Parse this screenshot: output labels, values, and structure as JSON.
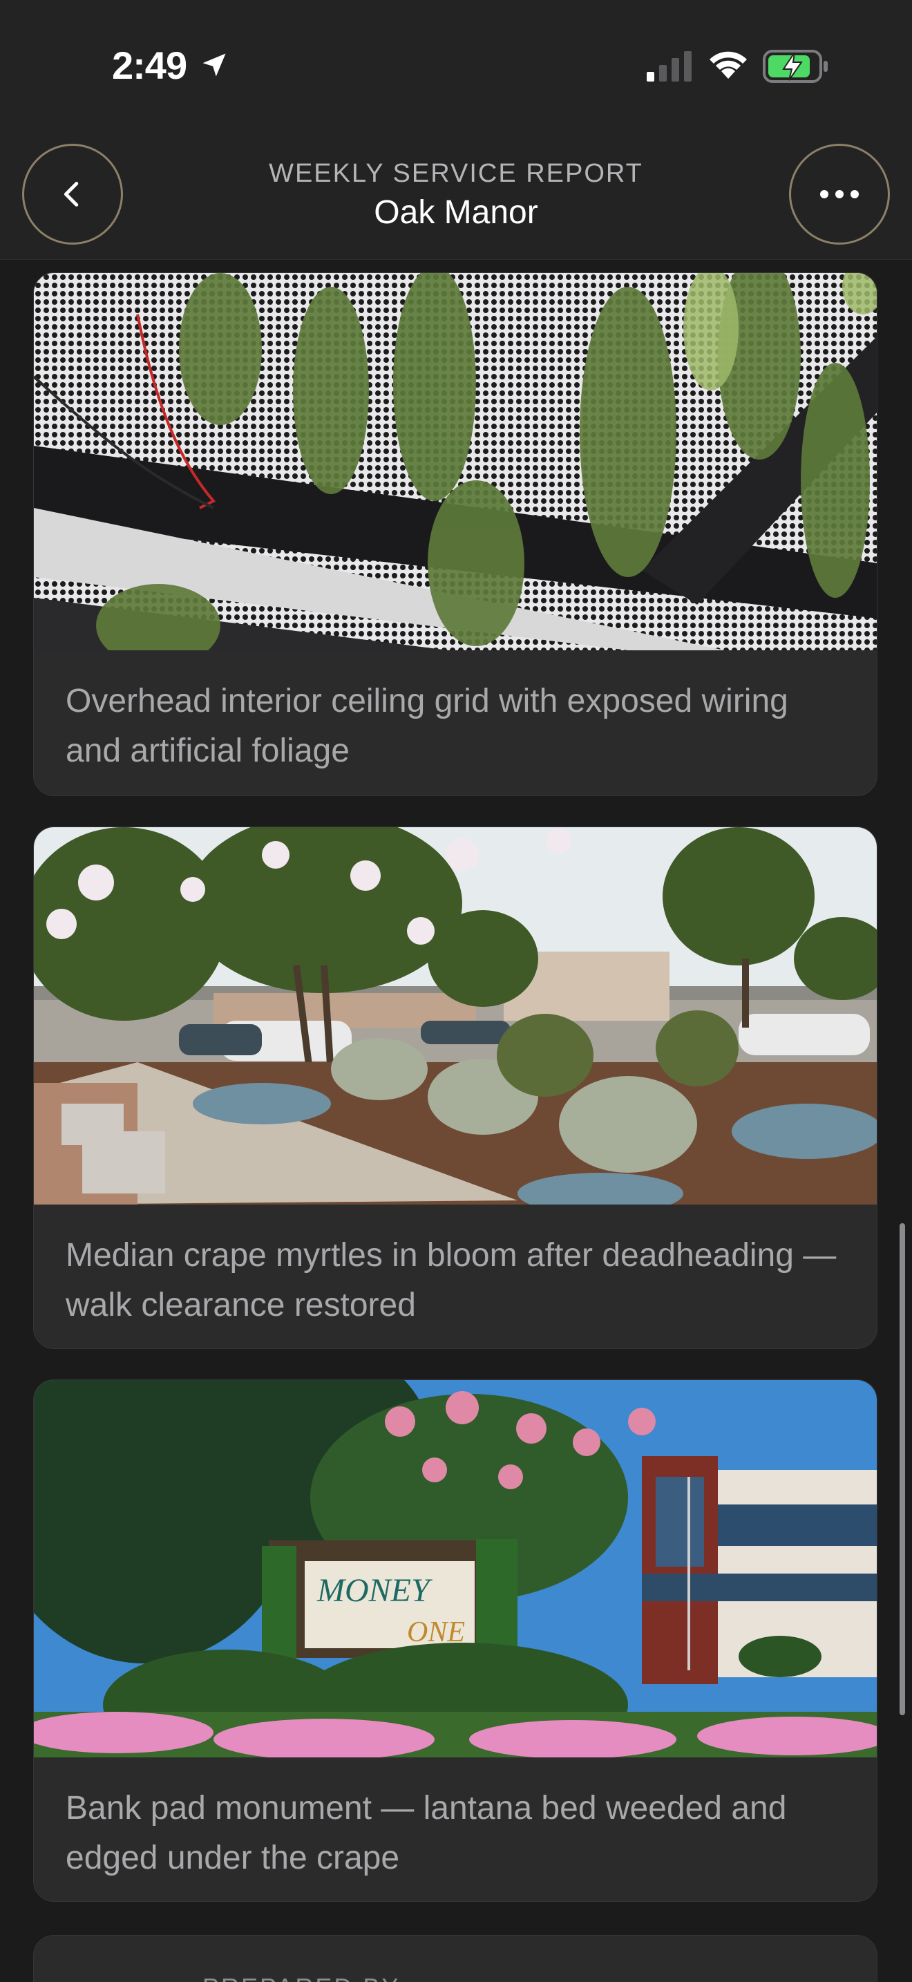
{
  "status_bar": {
    "time": "2:49",
    "icons": [
      "location-arrow-icon",
      "cellular-signal-icon",
      "wifi-icon",
      "battery-charging-icon"
    ]
  },
  "header": {
    "kicker": "WEEKLY SERVICE REPORT",
    "title": "Oak Manor",
    "back_icon": "chevron-left-icon",
    "more_icon": "ellipsis-icon"
  },
  "photos": [
    {
      "caption": "Overhead interior ceiling grid with exposed wiring and artificial foliage"
    },
    {
      "caption": "Median crape myrtles in bloom after deadheading — walk clearance restored"
    },
    {
      "caption": "Bank pad monument — lantana bed weeded and edged under the crape"
    }
  ],
  "footer_card": {
    "label": "PREPARED BY"
  },
  "colors": {
    "background": "#1b1b1c",
    "header": "#232324",
    "card": "#2b2b2c",
    "button_border": "#8c8068",
    "battery_charging": "#4cd964"
  }
}
